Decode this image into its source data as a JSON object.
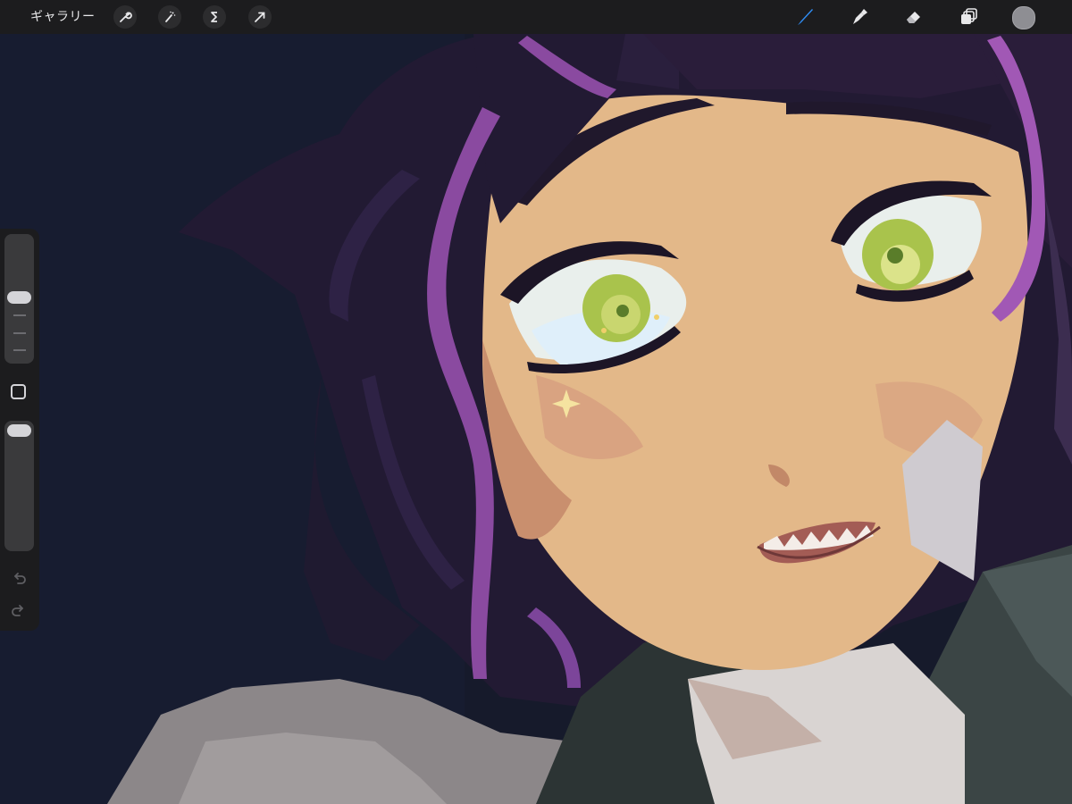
{
  "toolbar": {
    "gallery_label": "ギャラリー",
    "left_tools": [
      "wrench-icon",
      "magic-wand-icon",
      "selection-icon",
      "transform-arrow-icon"
    ],
    "right_tools": [
      "brush-icon",
      "smudge-icon",
      "eraser-icon",
      "layers-icon"
    ],
    "active_tool": "brush",
    "accent_color": "#2f8df5",
    "current_color": "#8e8e93"
  },
  "sidebar": {
    "size_slider_level": 0.35,
    "opacity_slider_level": 0.05,
    "undo_icon": "undo-icon",
    "redo_icon": "redo-icon"
  },
  "canvas": {
    "background_color": "#161a2b",
    "skin_color": "#e3b889",
    "hair_color": "#2a1c35",
    "hair_highlight": "#9b52a8",
    "eye_color": "#a9c34c"
  }
}
